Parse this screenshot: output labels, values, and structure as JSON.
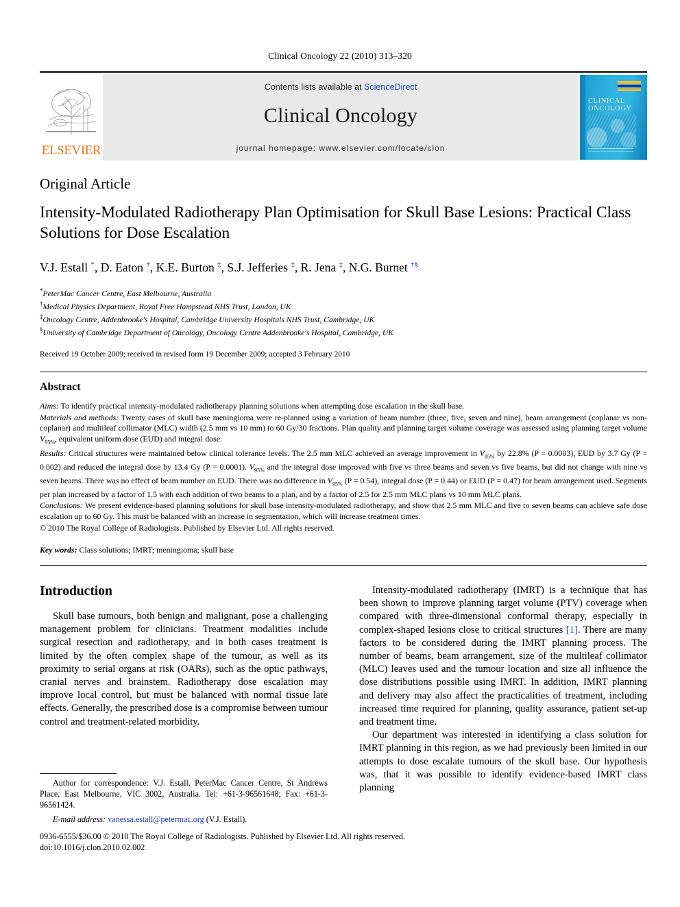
{
  "running_head": "Clinical Oncology 22 (2010) 313–320",
  "masthead": {
    "publisher_logo_label": "ELSEVIER",
    "contents_prefix": "Contents lists available at ",
    "contents_link": "ScienceDirect",
    "journal_name": "Clinical Oncology",
    "homepage": "journal homepage: www.elsevier.com/locate/clon",
    "cover": {
      "title_line1": "CLINICAL",
      "title_line2": "ONCOLOGY",
      "bar_colors": [
        "#f2c230",
        "#3b2a6b",
        "#e8b93a"
      ]
    }
  },
  "article": {
    "type": "Original Article",
    "title": "Intensity-Modulated Radiotherapy Plan Optimisation for Skull Base Lesions: Practical Class Solutions for Dose Escalation",
    "authors_html": "V.J. Estall <sup>*</sup>, D. Eaton <sup>†</sup>, K.E. Burton <sup>‡</sup>, S.J. Jefferies <sup>‡</sup>, R. Jena <sup>‡</sup>, N.G. Burnet <sup>†§</sup>",
    "affiliations": [
      {
        "marker": "*",
        "text": "PeterMac Cancer Centre, East Melbourne, Australia"
      },
      {
        "marker": "†",
        "text": "Medical Physics Department, Royal Free Hampstead NHS Trust, London, UK"
      },
      {
        "marker": "‡",
        "text": "Oncology Centre, Addenbrooke's Hospital, Cambridge University Hospitals NHS Trust, Cambridge, UK"
      },
      {
        "marker": "§",
        "text": "University of Cambridge Department of Oncology, Oncology Centre Addenbrooke's Hospital, Cambridge, UK"
      }
    ],
    "history": "Received 19 October 2009; received in revised form 19 December 2009; accepted 3 February 2010"
  },
  "abstract": {
    "heading": "Abstract",
    "aims_label": "Aims:",
    "aims_text": " To identify practical intensity-modulated radiotherapy planning solutions when attempting dose escalation in the skull base.",
    "methods_label": "Materials and methods:",
    "methods_text": " Twenty cases of skull base meningioma were re-planned using a variation of beam number (three, five, seven and nine), beam arrangement (coplanar vs non-coplanar) and multileaf collimator (MLC) width (2.5 mm vs 10 mm) to 60 Gy/30 fractions. Plan quality and planning target volume coverage was assessed using planning target volume V95%, equivalent uniform dose (EUD) and integral dose.",
    "results_label": "Results:",
    "results_text": " Critical structures were maintained below clinical tolerance levels. The 2.5 mm MLC achieved an average improvement in V95% by 22.8% (P = 0.0003), EUD by 3.7 Gy (P = 0.002) and reduced the integral dose by 13.4 Gy (P = 0.0001). V95% and the integral dose improved with five vs three beams and seven vs five beams, but did not change with nine vs seven beams. There was no effect of beam number on EUD. There was no difference in V95% (P = 0.54), integral dose (P = 0.44) or EUD (P = 0.47) for beam arrangement used. Segments per plan increased by a factor of 1.5 with each addition of two beams to a plan, and by a factor of 2.5 for 2.5 mm MLC plans vs 10 mm MLC plans.",
    "conclusions_label": "Conclusions:",
    "conclusions_text": " We present evidence-based planning solutions for skull base intensity-modulated radiotherapy, and show that 2.5 mm MLC and five to seven beams can achieve safe dose escalation up to 60 Gy. This must be balanced with an increase in segmentation, which will increase treatment times.",
    "copyright": "© 2010 The Royal College of Radiologists. Published by Elsevier Ltd. All rights reserved.",
    "keywords_label": "Key words:",
    "keywords_text": " Class solutions; IMRT; meningioma; skull base"
  },
  "introduction": {
    "heading": "Introduction",
    "left_paragraph": "Skull base tumours, both benign and malignant, pose a challenging management problem for clinicians. Treatment modalities include surgical resection and radiotherapy, and in both cases treatment is limited by the often complex shape of the tumour, as well as its proximity to serial organs at risk (OARs), such as the optic pathways, cranial nerves and brainstem. Radiotherapy dose escalation may improve local control, but must be balanced with normal tissue late effects. Generally, the prescribed dose is a compromise between tumour control and treatment-related morbidity.",
    "right_paragraph_1a": "Intensity-modulated radiotherapy (IMRT) is a technique that has been shown to improve planning target volume (PTV) coverage when compared with three-dimensional conformal therapy, especially in complex-shaped lesions close to critical structures ",
    "right_reference": "[1]",
    "right_paragraph_1b": ". There are many factors to be considered during the IMRT planning process. The number of beams, beam arrangement, size of the multileaf collimator (MLC) leaves used and the tumour location and size all influence the dose distributions possible using IMRT. In addition, IMRT planning and delivery may also affect the practicalities of treatment, including increased time required for planning, quality assurance, patient set-up and treatment time.",
    "right_paragraph_2": "Our department was interested in identifying a class solution for IMRT planning in this region, as we had previously been limited in our attempts to dose escalate tumours of the skull base. Our hypothesis was, that it was possible to identify evidence-based IMRT class planning"
  },
  "footnote": {
    "correspondence": "Author for correspondence: V.J. Estall, PeterMac Cancer Centre, St Andrews Place, East Melbourne, VIC 3002, Australia. Tel: +61-3-96561648; Fax: +61-3-96561424.",
    "email_label": "E-mail address:",
    "email": "vanessa.estall@petermac.org",
    "email_suffix": " (V.J. Estall)."
  },
  "imprint": {
    "line1": "0936-6555/$36.00 © 2010 The Royal College of Radiologists. Published by Elsevier Ltd. All rights reserved.",
    "line2": "doi:10.1016/j.clon.2010.02.002"
  }
}
